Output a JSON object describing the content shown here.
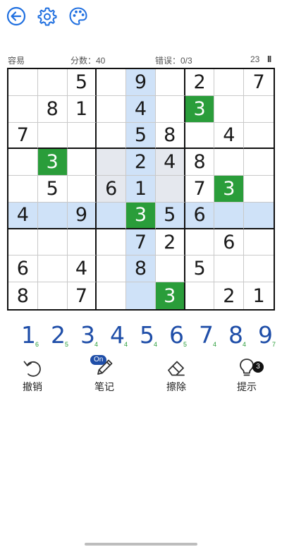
{
  "toolbar": {
    "icons": [
      "back-arrow-icon",
      "gear-icon",
      "palette-icon"
    ],
    "accent": "#1f6fe0"
  },
  "status": {
    "difficulty": "容易",
    "score": "分数：40",
    "errors": "错误：0/3",
    "timer": "23",
    "pause": "II"
  },
  "board": {
    "grid": [
      [
        "",
        "",
        "5",
        "",
        "9",
        "",
        "2",
        "",
        "7"
      ],
      [
        "",
        "8",
        "1",
        "",
        "4",
        "",
        "3",
        "",
        ""
      ],
      [
        "7",
        "",
        "",
        "",
        "5",
        "8",
        "",
        "4",
        ""
      ],
      [
        "",
        "3",
        "",
        "",
        "2",
        "4",
        "8",
        "",
        ""
      ],
      [
        "",
        "5",
        "",
        "6",
        "1",
        "",
        "7",
        "3",
        ""
      ],
      [
        "4",
        "",
        "9",
        "",
        "3",
        "5",
        "6",
        "",
        ""
      ],
      [
        "",
        "",
        "",
        "",
        "7",
        "2",
        "",
        "6",
        ""
      ],
      [
        "6",
        "",
        "4",
        "",
        "8",
        "",
        "5",
        "",
        ""
      ],
      [
        "8",
        "",
        "7",
        "",
        "",
        "3",
        "",
        "2",
        "1"
      ]
    ],
    "selected": {
      "row": 5,
      "col": 4,
      "value": "3"
    },
    "colors": {
      "highlight": "#cfe2f8",
      "box": "#e5e8ee",
      "same_number": "#2a9d3a",
      "given_text": "#1a1a1a"
    }
  },
  "numpad": [
    {
      "digit": "1",
      "remaining": "6"
    },
    {
      "digit": "2",
      "remaining": "5"
    },
    {
      "digit": "3",
      "remaining": "4"
    },
    {
      "digit": "4",
      "remaining": "4"
    },
    {
      "digit": "5",
      "remaining": "4"
    },
    {
      "digit": "6",
      "remaining": "5"
    },
    {
      "digit": "7",
      "remaining": "4"
    },
    {
      "digit": "8",
      "remaining": "4"
    },
    {
      "digit": "9",
      "remaining": "7"
    }
  ],
  "tools": {
    "undo": {
      "label": "撤销",
      "icon": "undo-icon"
    },
    "notes": {
      "label": "笔记",
      "icon": "pencil-icon",
      "badge": "On"
    },
    "erase": {
      "label": "擦除",
      "icon": "eraser-icon"
    },
    "hint": {
      "label": "提示",
      "icon": "lightbulb-icon",
      "badge": "3"
    }
  }
}
